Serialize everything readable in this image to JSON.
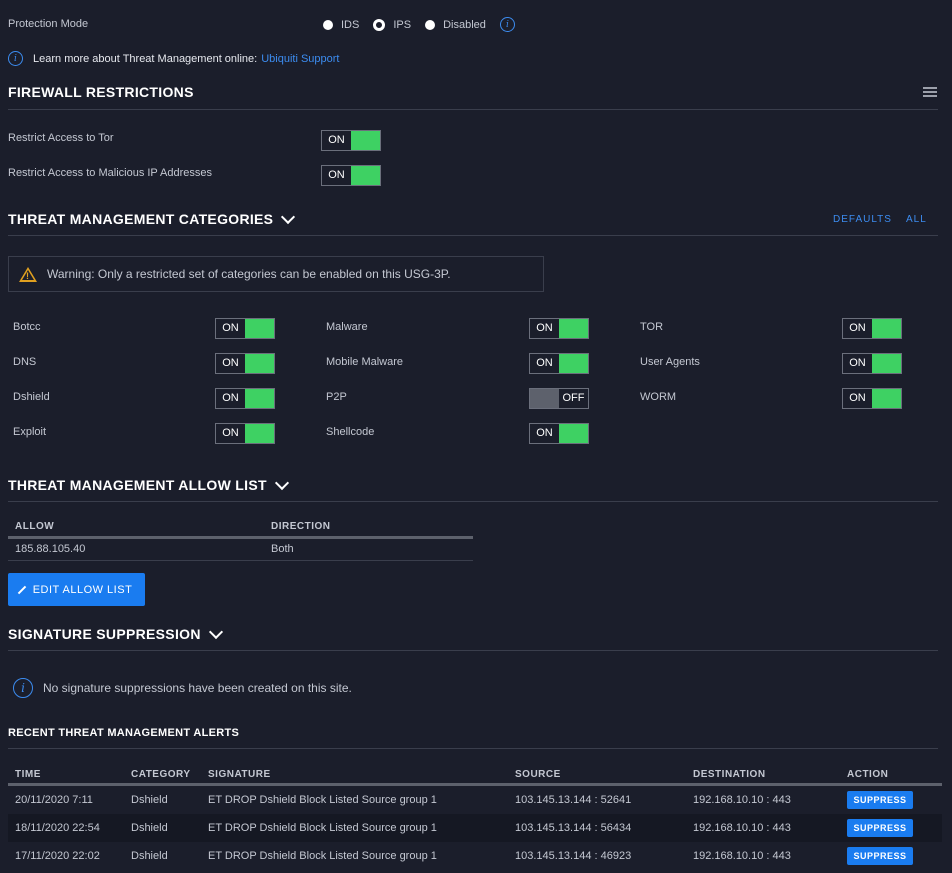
{
  "protection": {
    "label": "Protection Mode",
    "options": [
      "IDS",
      "IPS",
      "Disabled"
    ],
    "selected": "IPS"
  },
  "learn_more": {
    "text": "Learn more about Threat Management online:",
    "link": "Ubiquiti Support"
  },
  "firewall": {
    "title": "FIREWALL RESTRICTIONS",
    "items": [
      {
        "label": "Restrict Access to Tor",
        "state": "ON"
      },
      {
        "label": "Restrict Access to Malicious IP Addresses",
        "state": "ON"
      }
    ]
  },
  "categories": {
    "title": "THREAT MANAGEMENT CATEGORIES",
    "defaults_link": "DEFAULTS",
    "all_link": "ALL",
    "warning": "Warning: Only a restricted set of categories can be enabled on this USG-3P.",
    "col1": [
      {
        "label": "Botcc",
        "state": "ON"
      },
      {
        "label": "DNS",
        "state": "ON"
      },
      {
        "label": "Dshield",
        "state": "ON"
      },
      {
        "label": "Exploit",
        "state": "ON"
      }
    ],
    "col2": [
      {
        "label": "Malware",
        "state": "ON"
      },
      {
        "label": "Mobile Malware",
        "state": "ON"
      },
      {
        "label": "P2P",
        "state": "OFF"
      },
      {
        "label": "Shellcode",
        "state": "ON"
      }
    ],
    "col3": [
      {
        "label": "TOR",
        "state": "ON"
      },
      {
        "label": "User Agents",
        "state": "ON"
      },
      {
        "label": "WORM",
        "state": "ON"
      }
    ]
  },
  "allow_list": {
    "title": "THREAT MANAGEMENT ALLOW LIST",
    "headers": {
      "allow": "ALLOW",
      "direction": "DIRECTION"
    },
    "rows": [
      {
        "allow": "185.88.105.40",
        "direction": "Both"
      }
    ],
    "edit_button": "EDIT ALLOW LIST"
  },
  "suppression": {
    "title": "SIGNATURE SUPPRESSION",
    "empty_text": "No signature suppressions have been created on this site."
  },
  "alerts": {
    "title": "RECENT THREAT MANAGEMENT ALERTS",
    "headers": {
      "time": "TIME",
      "category": "CATEGORY",
      "signature": "SIGNATURE",
      "source": "SOURCE",
      "destination": "DESTINATION",
      "action": "ACTION"
    },
    "rows": [
      {
        "time": "20/11/2020 7:11",
        "category": "Dshield",
        "signature": "ET DROP Dshield Block Listed Source group 1",
        "source": "103.145.13.144 : 52641",
        "destination": "192.168.10.10 : 443",
        "action": "SUPPRESS"
      },
      {
        "time": "18/11/2020 22:54",
        "category": "Dshield",
        "signature": "ET DROP Dshield Block Listed Source group 1",
        "source": "103.145.13.144 : 56434",
        "destination": "192.168.10.10 : 443",
        "action": "SUPPRESS"
      },
      {
        "time": "17/11/2020 22:02",
        "category": "Dshield",
        "signature": "ET DROP Dshield Block Listed Source group 1",
        "source": "103.145.13.144 : 46923",
        "destination": "192.168.10.10 : 443",
        "action": "SUPPRESS"
      }
    ]
  },
  "colors": {
    "background": "#1b1e2b",
    "accent": "#1a7cf0",
    "toggle_on": "#3ed163",
    "toggle_off": "#5d616c",
    "warning": "#e0a020"
  }
}
